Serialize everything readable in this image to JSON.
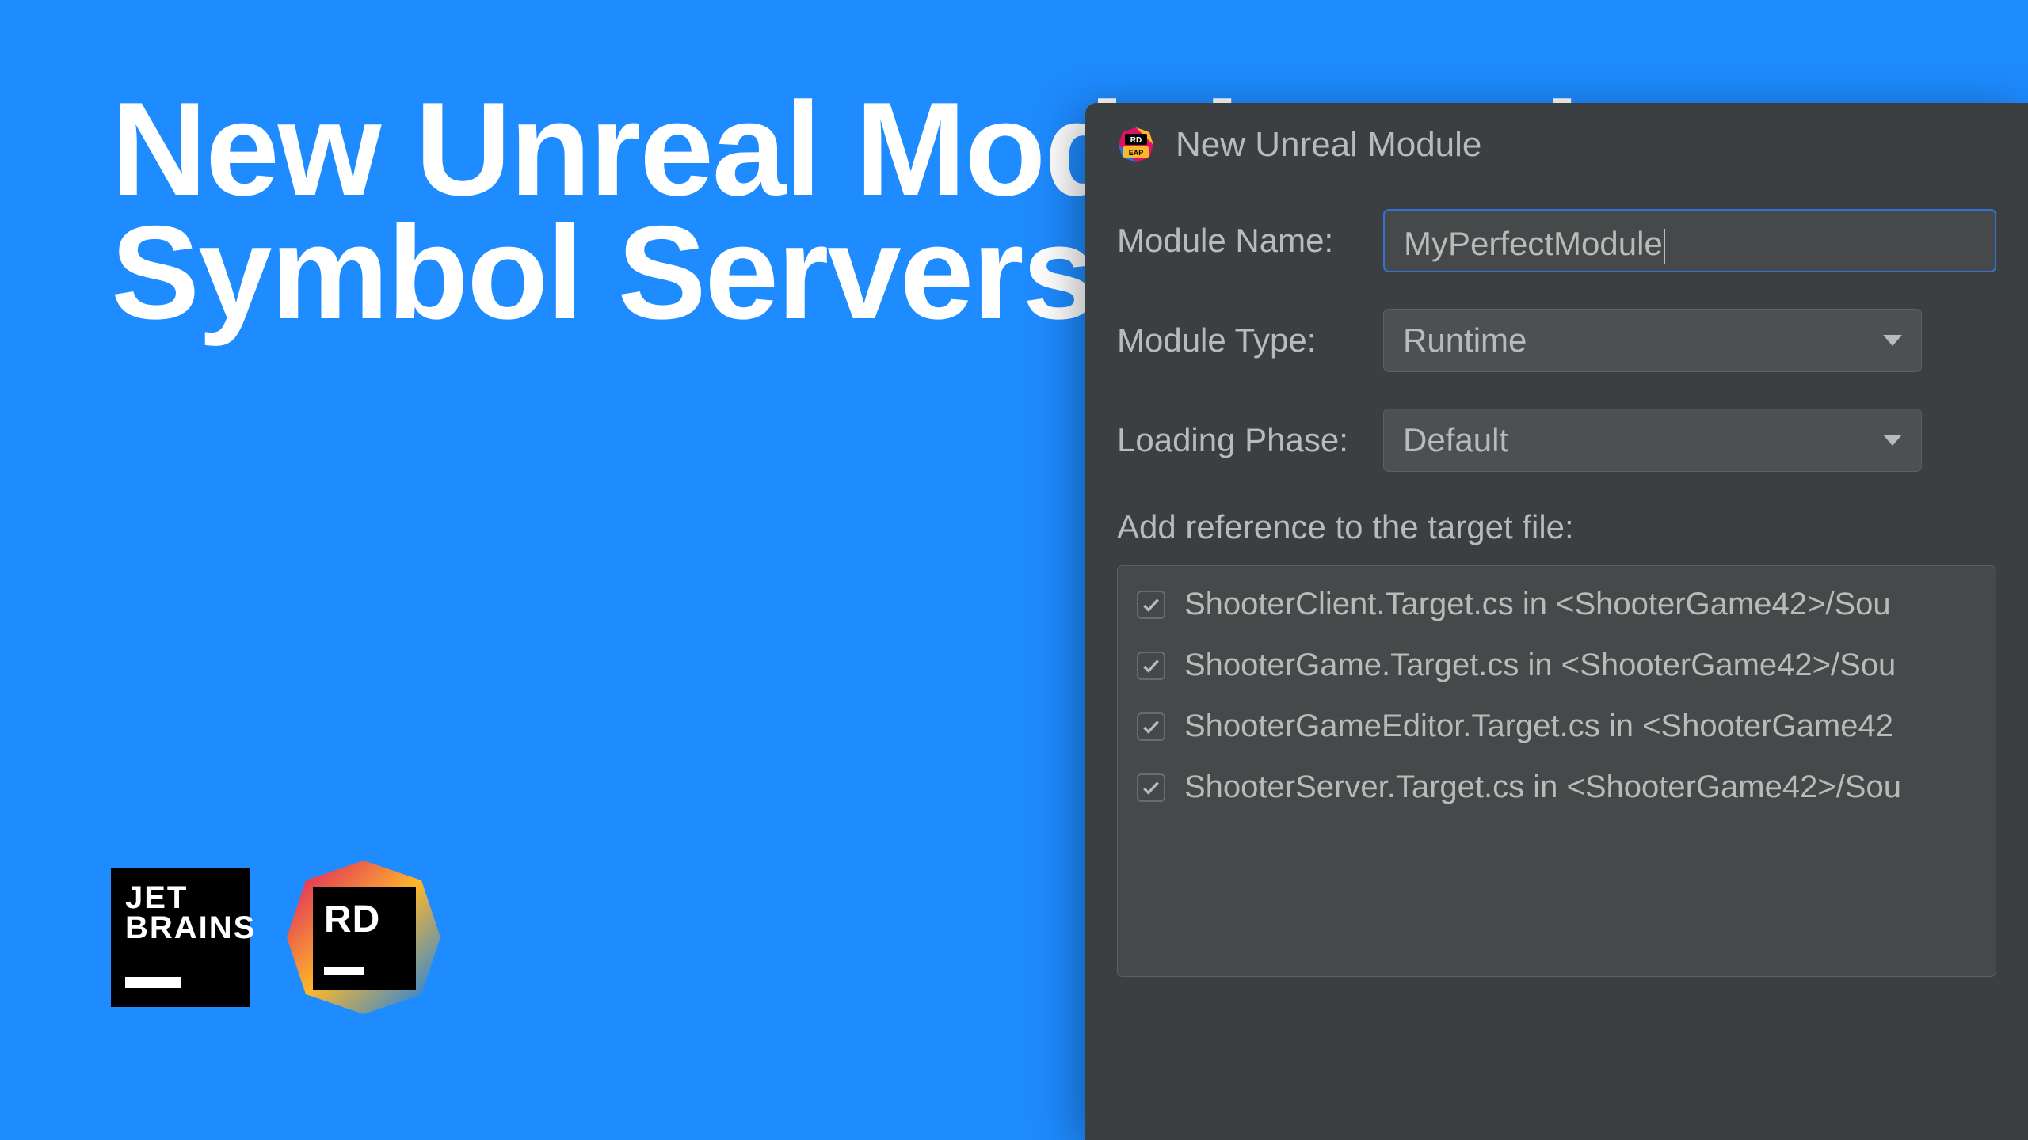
{
  "headline": "New Unreal Module and Symbol Servers in Rider",
  "logos": {
    "jetbrains_line1": "JET",
    "jetbrains_line2": "BRAINS",
    "rider_text": "RD"
  },
  "modal": {
    "icon_badge_top": "RD",
    "icon_badge_bottom": "EAP",
    "title": "New Unreal Module",
    "fields": {
      "module_name_label": "Module Name:",
      "module_name_value": "MyPerfectModule",
      "module_type_label": "Module Type:",
      "module_type_value": "Runtime",
      "loading_phase_label": "Loading Phase:",
      "loading_phase_value": "Default"
    },
    "reference_section_label": "Add reference to the target file:",
    "targets": [
      {
        "checked": true,
        "label": "ShooterClient.Target.cs in <ShooterGame42>/Sou"
      },
      {
        "checked": true,
        "label": "ShooterGame.Target.cs in <ShooterGame42>/Sou"
      },
      {
        "checked": true,
        "label": "ShooterGameEditor.Target.cs in <ShooterGame42"
      },
      {
        "checked": true,
        "label": "ShooterServer.Target.cs in <ShooterGame42>/Sou"
      }
    ]
  },
  "colors": {
    "bg_blue": "#1e8bff",
    "modal_bg": "#3c3f41",
    "input_bg": "#45494a",
    "select_bg": "#4c5052",
    "focus_border": "#3571d1",
    "text": "#bababa"
  }
}
